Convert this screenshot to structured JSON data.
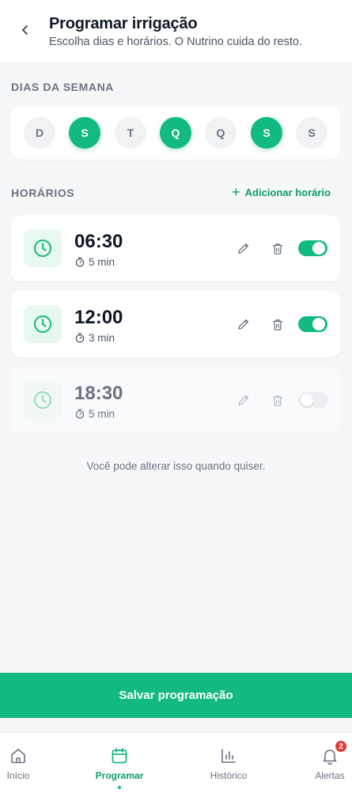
{
  "header": {
    "title": "Programar irrigação",
    "subtitle": "Escolha dias e horários. O Nutrino cuida do resto."
  },
  "days": {
    "section_label": "DIAS DA SEMANA",
    "items": [
      {
        "label": "D",
        "selected": false
      },
      {
        "label": "S",
        "selected": true
      },
      {
        "label": "T",
        "selected": false
      },
      {
        "label": "Q",
        "selected": true
      },
      {
        "label": "Q",
        "selected": false
      },
      {
        "label": "S",
        "selected": true
      },
      {
        "label": "S",
        "selected": false
      }
    ]
  },
  "schedules": {
    "section_label": "HORÁRIOS",
    "add_label": "Adicionar horário",
    "items": [
      {
        "time": "06:30",
        "duration": "5 min",
        "enabled": true
      },
      {
        "time": "12:00",
        "duration": "3 min",
        "enabled": true
      },
      {
        "time": "18:30",
        "duration": "5 min",
        "enabled": false
      }
    ]
  },
  "footnote": "Você pode alterar isso quando quiser.",
  "save_label": "Salvar programação",
  "tabbar": {
    "tabs": [
      {
        "label": "Início",
        "icon": "home-icon",
        "active": false
      },
      {
        "label": "Programar",
        "icon": "calendar-icon",
        "active": true
      },
      {
        "label": "Histórico",
        "icon": "bar-chart-icon",
        "active": false
      },
      {
        "label": "Alertas",
        "icon": "bell-icon",
        "active": false,
        "badge": "2"
      }
    ]
  },
  "colors": {
    "accent": "#12b981",
    "accent_text": "#0f9d6b",
    "badge": "#e53935"
  }
}
